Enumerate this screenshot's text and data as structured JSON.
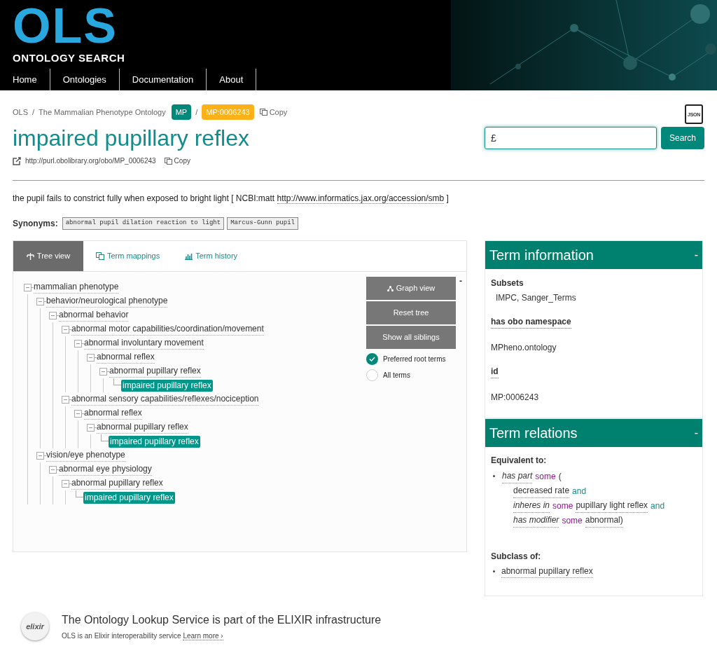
{
  "header": {
    "logo": "OLS",
    "tagline": "ONTOLOGY SEARCH",
    "nav": [
      {
        "label": "Home"
      },
      {
        "label": "Ontologies"
      },
      {
        "label": "Documentation"
      },
      {
        "label": "About"
      }
    ]
  },
  "breadcrumb": {
    "items": [
      "OLS",
      "The Mammalian Phenotype Ontology"
    ],
    "separators": [
      "/",
      "/"
    ],
    "ontology_badge": "MP",
    "term_badge": "MP:0006243",
    "copy": "Copy"
  },
  "json_icon": "JSON",
  "term": {
    "title": "impaired pupillary reflex",
    "iri": "http://purl.obolibrary.org/obo/MP_0006243",
    "copy": "Copy"
  },
  "search": {
    "value": "£",
    "button": "Search"
  },
  "definition": {
    "text": "the pupil fails to constrict fully when exposed to bright light",
    "xref_open": "[",
    "xref_source": "NCBI:matt",
    "xref_close": "]",
    "xref_url": "http://www.informatics.jax.org/accession/smb"
  },
  "synonyms": {
    "label": "Synonyms:",
    "items": [
      "abnormal pupil dilation reaction to light",
      "Marcus-Gunn pupil"
    ]
  },
  "tabs": [
    {
      "label": "Tree view",
      "selected": true
    },
    {
      "label": "Term mappings",
      "selected": false
    },
    {
      "label": "Term history",
      "selected": false
    }
  ],
  "tree": [
    {
      "label": "mammalian phenotype",
      "expanded": true,
      "children": [
        {
          "label": "behavior/neurological phenotype",
          "expanded": true,
          "children": [
            {
              "label": "abnormal behavior",
              "expanded": true,
              "children": [
                {
                  "label": "abnormal motor capabilities/coordination/movement",
                  "expanded": true,
                  "children": [
                    {
                      "label": "abnormal involuntary movement",
                      "expanded": true,
                      "children": [
                        {
                          "label": "abnormal reflex",
                          "expanded": true,
                          "children": [
                            {
                              "label": "abnormal pupillary reflex",
                              "expanded": true,
                              "children": [
                                {
                                  "label": "impaired pupillary reflex",
                                  "selected": true
                                }
                              ]
                            }
                          ]
                        }
                      ]
                    }
                  ]
                },
                {
                  "label": "abnormal sensory capabilities/reflexes/nociception",
                  "expanded": true,
                  "children": [
                    {
                      "label": "abnormal reflex",
                      "expanded": true,
                      "children": [
                        {
                          "label": "abnormal pupillary reflex",
                          "expanded": true,
                          "children": [
                            {
                              "label": "impaired pupillary reflex",
                              "selected": true
                            }
                          ]
                        }
                      ]
                    }
                  ]
                }
              ]
            }
          ]
        },
        {
          "label": "vision/eye phenotype",
          "expanded": true,
          "children": [
            {
              "label": "abnormal eye physiology",
              "expanded": true,
              "children": [
                {
                  "label": "abnormal pupillary reflex",
                  "expanded": true,
                  "children": [
                    {
                      "label": "impaired pupillary reflex",
                      "selected": true
                    }
                  ]
                }
              ]
            }
          ]
        }
      ]
    }
  ],
  "tree_buttons": [
    {
      "label": "Graph view"
    },
    {
      "label": "Reset tree"
    },
    {
      "label": "Show all siblings"
    }
  ],
  "tree_collapse": "-",
  "root_options": [
    {
      "label": "Preferred root terms",
      "selected": true
    },
    {
      "label": "All terms",
      "selected": false
    }
  ],
  "term_information": {
    "title": "Term information",
    "toggle": "-",
    "fields": [
      {
        "label": "Subsets",
        "value": "IMPC, Sanger_Terms",
        "kind": "plain"
      },
      {
        "label": "has obo namespace",
        "value": "MPheno.ontology",
        "kind": "annotation"
      },
      {
        "label": "id",
        "value": "MP:0006243",
        "kind": "annotation"
      }
    ]
  },
  "term_relations": {
    "title": "Term relations",
    "toggle": "-",
    "equivalent_label": "Equivalent to:",
    "equivalent_lines": [
      [
        {
          "kind": "property",
          "text": "has part"
        },
        {
          "kind": "keyword",
          "text": "some"
        },
        {
          "kind": "text",
          "text": "("
        }
      ],
      [
        {
          "kind": "class",
          "text": "decreased rate"
        },
        {
          "kind": "operator",
          "text": "and"
        }
      ],
      [
        {
          "kind": "property",
          "text": "inheres in"
        },
        {
          "kind": "keyword",
          "text": "some"
        },
        {
          "kind": "class",
          "text": "pupillary light reflex"
        },
        {
          "kind": "operator",
          "text": "and"
        }
      ],
      [
        {
          "kind": "property",
          "text": "has modifier"
        },
        {
          "kind": "keyword",
          "text": "some"
        },
        {
          "kind": "class",
          "text": "abnormal)"
        }
      ]
    ],
    "subclass_label": "Subclass of:",
    "subclass_of": [
      "abnormal pupillary reflex"
    ]
  },
  "footer": {
    "logo": "elixir",
    "headline": "The Ontology Lookup Service is part of the ELIXIR infrastructure",
    "text": "OLS is an Elixir interoperability service",
    "link": "Learn more ›"
  }
}
